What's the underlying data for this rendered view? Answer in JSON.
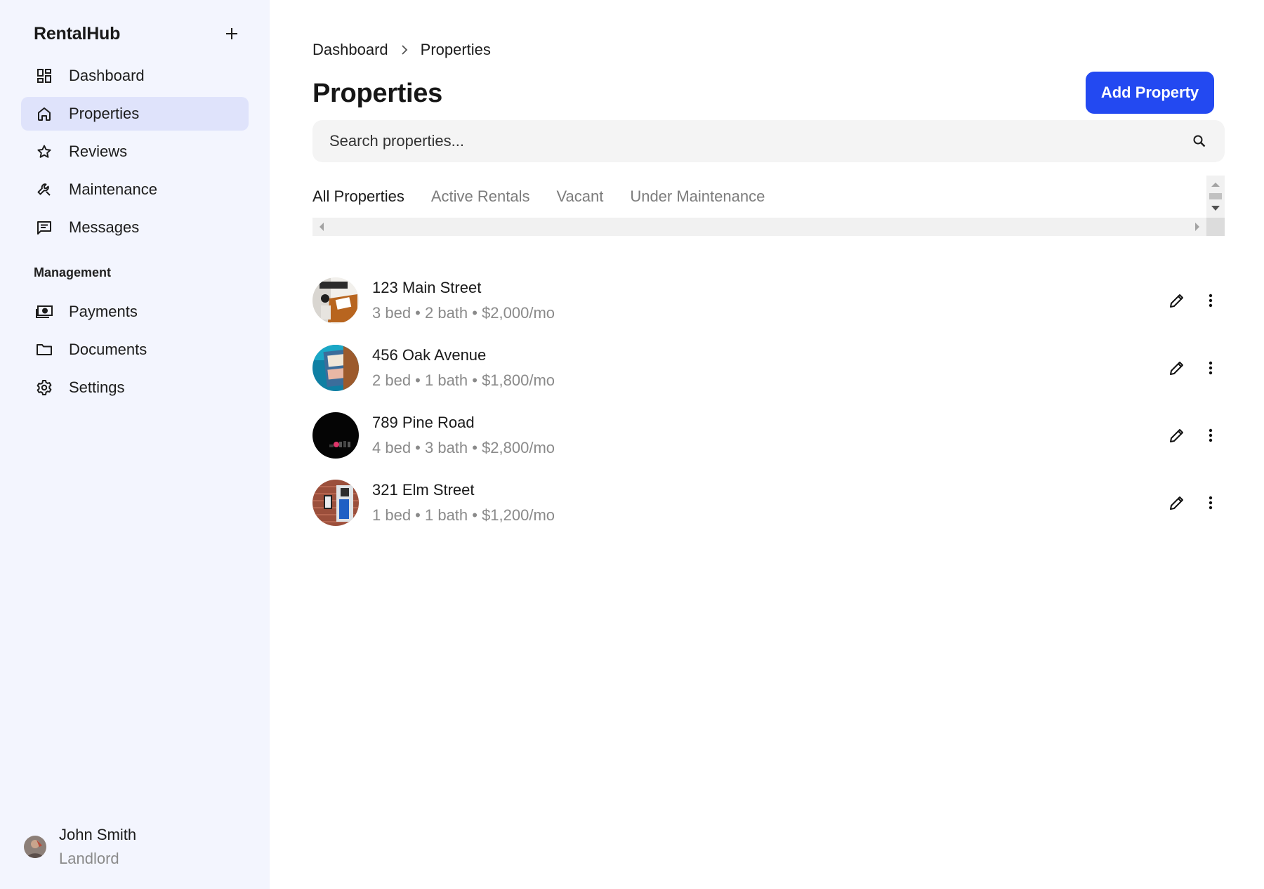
{
  "app": {
    "name": "RentalHub"
  },
  "sidebar": {
    "items": [
      {
        "label": "Dashboard",
        "icon": "dashboard-icon",
        "active": false
      },
      {
        "label": "Properties",
        "icon": "home-icon",
        "active": true
      },
      {
        "label": "Reviews",
        "icon": "star-icon",
        "active": false
      },
      {
        "label": "Maintenance",
        "icon": "wrench-icon",
        "active": false
      },
      {
        "label": "Messages",
        "icon": "message-icon",
        "active": false
      }
    ],
    "section_title": "Management",
    "management_items": [
      {
        "label": "Payments",
        "icon": "payments-icon"
      },
      {
        "label": "Documents",
        "icon": "folder-icon"
      },
      {
        "label": "Settings",
        "icon": "gear-icon"
      }
    ],
    "user": {
      "name": "John Smith",
      "role": "Landlord"
    }
  },
  "breadcrumb": [
    "Dashboard",
    "Properties"
  ],
  "page": {
    "title": "Properties",
    "add_button": "Add Property"
  },
  "search": {
    "placeholder": "Search properties..."
  },
  "tabs": [
    {
      "label": "All Properties",
      "active": true
    },
    {
      "label": "Active Rentals",
      "active": false
    },
    {
      "label": "Vacant",
      "active": false
    },
    {
      "label": "Under Maintenance",
      "active": false
    }
  ],
  "properties": [
    {
      "address": "123 Main Street",
      "details": "3 bed • 2 bath • $2,000/mo"
    },
    {
      "address": "456 Oak Avenue",
      "details": "2 bed • 1 bath • $1,800/mo"
    },
    {
      "address": "789 Pine Road",
      "details": "4 bed • 3 bath • $2,800/mo"
    },
    {
      "address": "321 Elm Street",
      "details": "1 bed • 1 bath • $1,200/mo"
    }
  ],
  "colors": {
    "accent": "#2349f1",
    "sidebar_bg": "#f3f5fe",
    "active_nav_bg": "#dfe3fb"
  }
}
